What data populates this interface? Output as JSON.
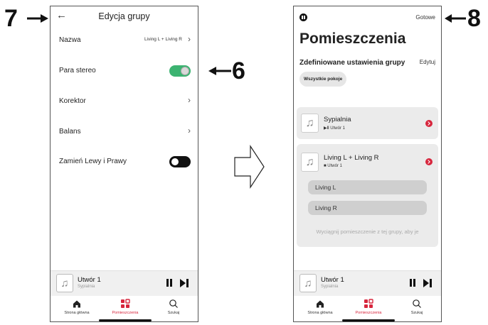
{
  "callouts": {
    "left": "7",
    "center": "6",
    "right": "8"
  },
  "left_screen": {
    "header": {
      "title": "Edycja grupy"
    },
    "settings": [
      {
        "label": "Nazwa",
        "value": "Living L + Living R"
      },
      {
        "label": "Para stereo",
        "toggle": "on"
      },
      {
        "label": "Korektor"
      },
      {
        "label": "Balans"
      },
      {
        "label": "Zamień Lewy i Prawy",
        "toggle": "off"
      }
    ],
    "player": {
      "title": "Utwór 1",
      "subtitle": "Sypialnia"
    },
    "tabs": [
      {
        "label": "Strona główna",
        "icon": "home-icon"
      },
      {
        "label": "Pomieszczenia",
        "icon": "rooms-icon",
        "active": true
      },
      {
        "label": "Szukaj",
        "icon": "search-icon"
      }
    ]
  },
  "right_screen": {
    "done_label": "Gotowe",
    "title": "Pomieszczenia",
    "presets_title": "Zdefiniowane ustawienia grupy",
    "edit_label": "Edytuj",
    "chip_label": "Wszystkie pokoje",
    "rooms": [
      {
        "name": "Sypialnia",
        "track": "Utwór 1"
      },
      {
        "name": "Living L + Living R",
        "track": "Utwór 1",
        "members": [
          "Living L",
          "Living R"
        ]
      }
    ],
    "hint": "Wyciągnij pomieszczenie z tej grupy, aby je",
    "player": {
      "title": "Utwór 1",
      "subtitle": "Sypialnia"
    },
    "tabs": [
      {
        "label": "Strona główna",
        "icon": "home-icon"
      },
      {
        "label": "Pomieszczenia",
        "icon": "rooms-icon",
        "active": true
      },
      {
        "label": "Szukaj",
        "icon": "search-icon"
      }
    ]
  },
  "colors": {
    "accent": "#d7263d",
    "toggle_on": "#3cb371"
  }
}
